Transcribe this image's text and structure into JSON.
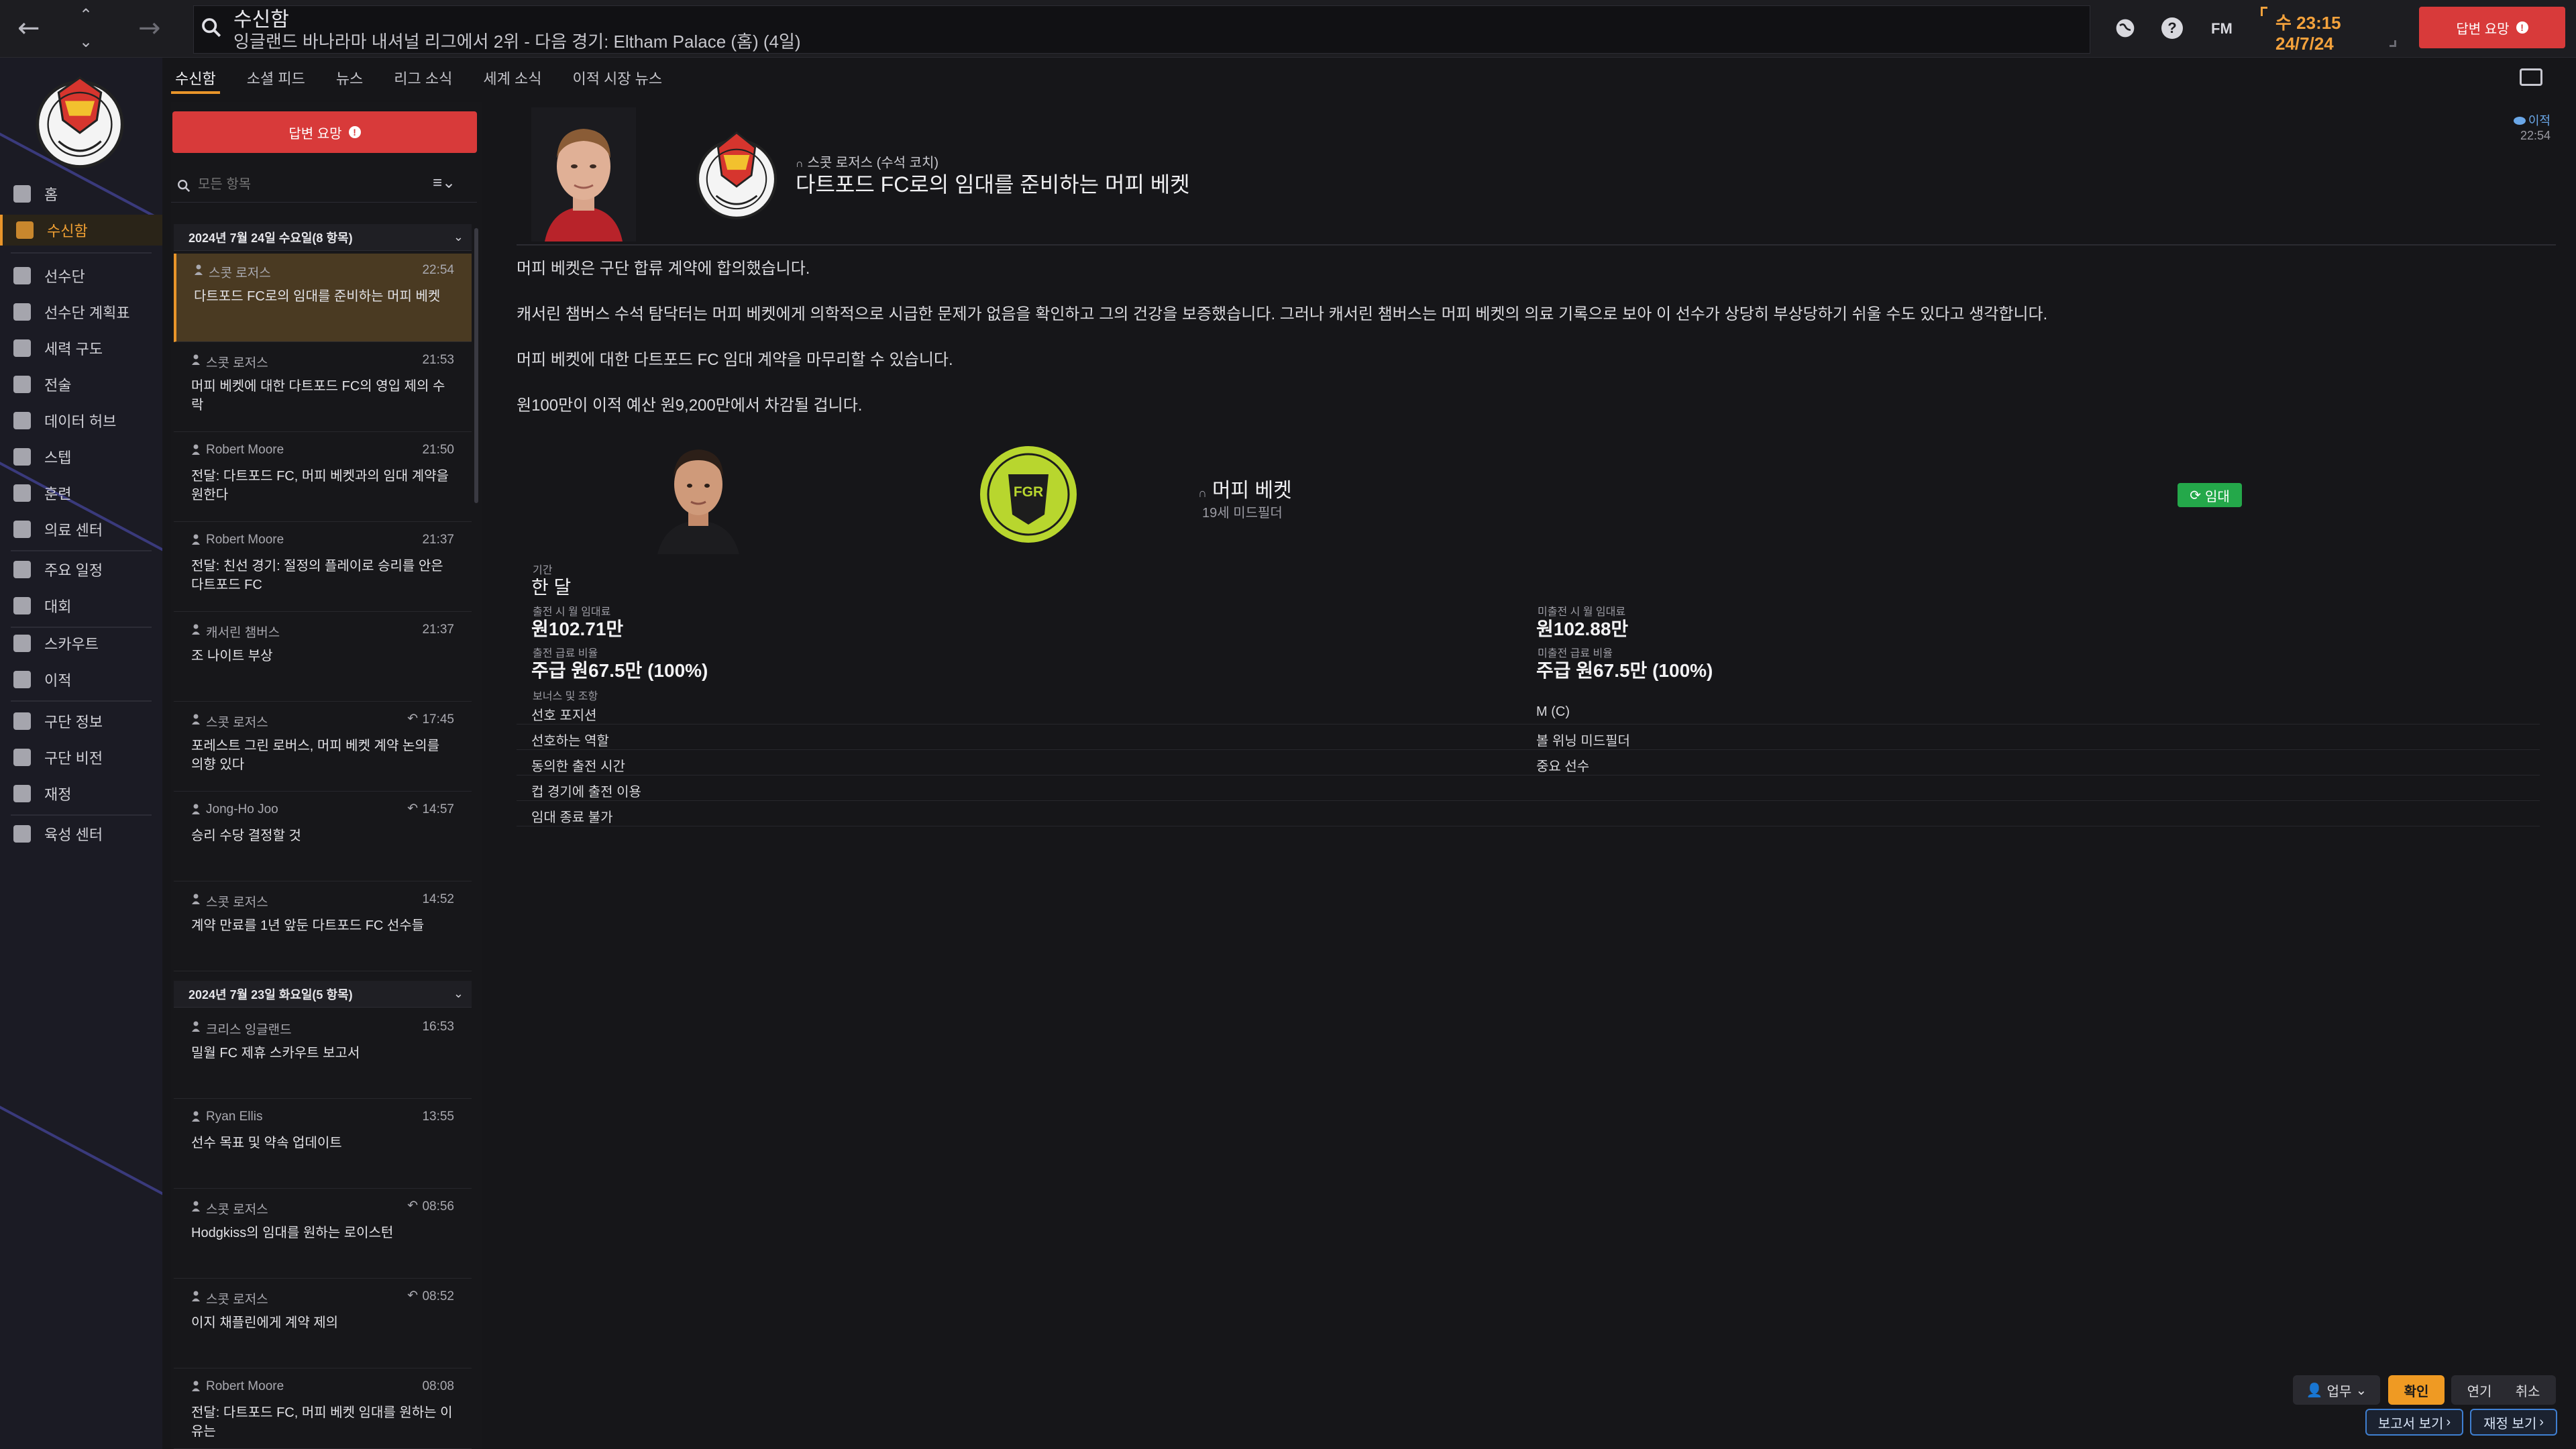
{
  "topbar": {
    "title": "수신함",
    "subtitle": "잉글랜드 바나라마 내셔널 리그에서 2위 - 다음 경기: Eltham Palace (홈) (4일)",
    "fm_label": "FM",
    "help_label": "?",
    "date_day": "수 23:15",
    "date": "24/7/24",
    "reply_button": "답변 요망"
  },
  "sidebar": {
    "items": [
      {
        "label": "홈"
      },
      {
        "label": "수신함"
      },
      {
        "label": "선수단"
      },
      {
        "label": "선수단 계획표"
      },
      {
        "label": "세력 구도"
      },
      {
        "label": "전술"
      },
      {
        "label": "데이터 허브"
      },
      {
        "label": "스텝"
      },
      {
        "label": "훈련"
      },
      {
        "label": "의료 센터"
      },
      {
        "label": "주요 일정"
      },
      {
        "label": "대회"
      },
      {
        "label": "스카우트"
      },
      {
        "label": "이적"
      },
      {
        "label": "구단 정보"
      },
      {
        "label": "구단 비전"
      },
      {
        "label": "재정"
      },
      {
        "label": "육성 센터"
      }
    ]
  },
  "tabs": [
    "수신함",
    "소셜 피드",
    "뉴스",
    "리그 소식",
    "세계 소식",
    "이적 시장 뉴스"
  ],
  "inbox": {
    "reply_button": "답변 요망",
    "search_placeholder": "모든 항목",
    "groups": [
      {
        "header": "2024년 7월 24일 수요일(8 항목)",
        "messages": [
          {
            "sender": "스콧 로저스",
            "time": "22:54",
            "subject": "다트포드 FC로의 임대를 준비하는 머피 베켓",
            "reply": ""
          },
          {
            "sender": "스콧 로저스",
            "time": "21:53",
            "subject": "머피 베켓에 대한 다트포드 FC의 영입 제의 수락",
            "reply": ""
          },
          {
            "sender": "Robert Moore",
            "time": "21:50",
            "subject": "전달: 다트포드 FC, 머피 베켓과의 임대 계약을 원한다",
            "reply": ""
          },
          {
            "sender": "Robert Moore",
            "time": "21:37",
            "subject": "전달: 친선 경기: 절정의 플레이로 승리를 안은 다트포드 FC",
            "reply": ""
          },
          {
            "sender": "캐서린 챔버스",
            "time": "21:37",
            "subject": "조 나이트 부상",
            "reply": ""
          },
          {
            "sender": "스콧 로저스",
            "time": "17:45",
            "subject": "포레스트 그린 로버스, 머피 베켓 계약 논의를 의향 있다",
            "reply": "↶"
          },
          {
            "sender": "Jong-Ho Joo",
            "time": "14:57",
            "subject": "승리 수당 결정할 것",
            "reply": "↶"
          },
          {
            "sender": "스콧 로저스",
            "time": "14:52",
            "subject": "계약 만료를 1년 앞둔 다트포드 FC 선수들",
            "reply": ""
          }
        ]
      },
      {
        "header": "2024년 7월 23일 화요일(5 항목)",
        "messages": [
          {
            "sender": "크리스 잉글랜드",
            "time": "16:53",
            "subject": "밀월 FC 제휴 스카우트 보고서",
            "reply": ""
          },
          {
            "sender": "Ryan Ellis",
            "time": "13:55",
            "subject": "선수 목표 및 약속 업데이트",
            "reply": ""
          },
          {
            "sender": "스콧 로저스",
            "time": "08:56",
            "subject": "Hodgkiss의 임대를 원하는 로이스턴",
            "reply": "↶"
          },
          {
            "sender": "스콧 로저스",
            "time": "08:52",
            "subject": "이지 채플린에게 계약 제의",
            "reply": "↶"
          },
          {
            "sender": "Robert Moore",
            "time": "08:08",
            "subject": "전달: 다트포드 FC, 머피 베켓 임대를 원하는 이유는",
            "reply": ""
          }
        ]
      }
    ]
  },
  "message": {
    "sender": "스콧 로저스 (수석 코치)",
    "title": "다트포드 FC로의 임대를 준비하는 머피 베켓",
    "tag": "이적",
    "time": "22:54",
    "paragraphs": [
      "머피 베켓은 구단 합류 계약에 합의했습니다.",
      "캐서린 챔버스 수석 탐닥터는 머피 베켓에게 의학적으로 시급한 문제가 없음을 확인하고 그의 건강을 보증했습니다. 그러나 캐서린 챔버스는 머피 베켓의 의료 기록으로 보아 이 선수가 상당히 부상당하기 쉬울 수도 있다고 생각합니다.",
      "머피 베켓에 대한 다트포드 FC 임대 계약을 마무리할 수 있습니다.",
      "원100만이 이적 예산 원9,200만에서 차감될 겁니다."
    ],
    "loan": {
      "player_name": "머피 베켓",
      "player_info": "19세 미드필더",
      "status_badge": "임대",
      "club_badge_text": "FGR",
      "period_label": "기간",
      "period_value": "한 달",
      "monthly_fee_label": "출전 시 월 임대료",
      "monthly_fee_value": "원102.71만",
      "non_play_fee_label": "미출전 시 월 임대료",
      "non_play_fee_value": "원102.88만",
      "wage_label": "출전 급료 비율",
      "wage_value": "주급 원67.5만 (100%)",
      "non_play_wage_label": "미출전 급료 비율",
      "non_play_wage_value": "주급 원67.5만 (100%)",
      "bonus_label": "보너스 및 조항",
      "rows": [
        {
          "left": "선호 포지션",
          "right": "M (C)"
        },
        {
          "left": "선호하는 역할",
          "right": "볼 위닝 미드필더"
        },
        {
          "left": "동의한 출전 시간",
          "right": "중요 선수"
        },
        {
          "left": "컵 경기에 출전 이용",
          "right": ""
        },
        {
          "left": "임대 종료 불가",
          "right": ""
        }
      ]
    }
  },
  "footer": {
    "duty_button": "업무",
    "confirm_button": "확인",
    "delay_button": "연기",
    "cancel_button": "취소",
    "report_button": "보고서 보기",
    "finance_button": "재정 보기"
  },
  "colors": {
    "accent": "#e9952a",
    "reply_red": "#d83a3a",
    "loan_green": "#24a84a",
    "link_blue": "#3f7fd1"
  }
}
